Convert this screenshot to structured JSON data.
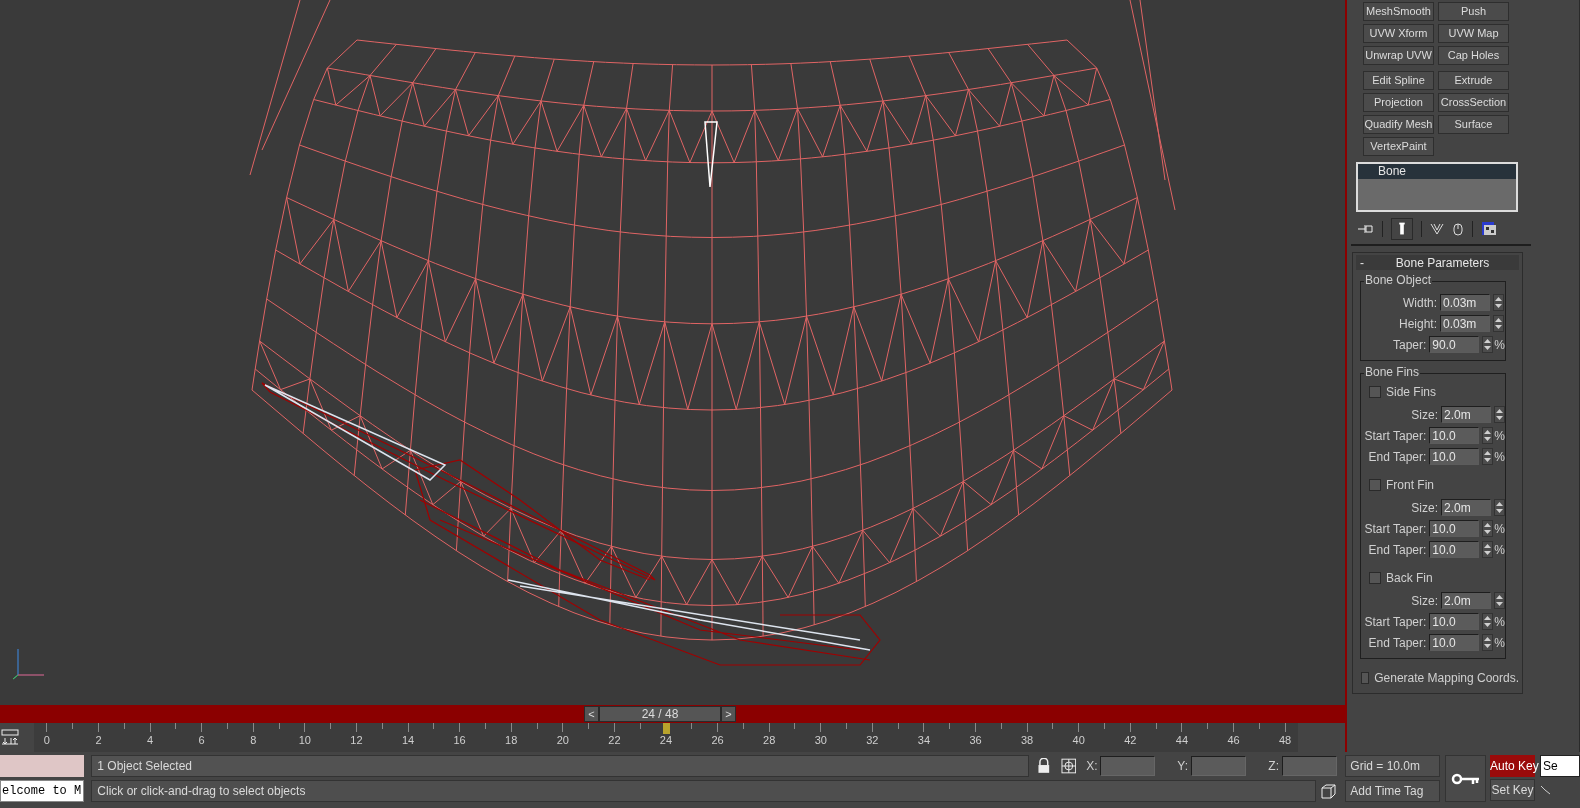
{
  "viewport": {
    "time_slider": {
      "prev": "<",
      "label": "24 / 48",
      "next": ">"
    }
  },
  "timeline": {
    "ticks": [
      "0",
      "2",
      "4",
      "6",
      "8",
      "10",
      "12",
      "14",
      "16",
      "18",
      "20",
      "22",
      "24",
      "26",
      "28",
      "30",
      "32",
      "34",
      "36",
      "38",
      "40",
      "42",
      "44",
      "46",
      "48"
    ],
    "level": 0.5
  },
  "command_panel": {
    "modifier_groups": [
      [
        "MeshSmooth",
        "Push",
        "UVW Xform",
        "UVW Map",
        "Unwrap UVW",
        "Cap Holes"
      ],
      [
        "Edit Spline",
        "Extrude",
        "Projection",
        "CrossSection",
        "Quadify Mesh",
        "Surface",
        "VertexPaint"
      ]
    ],
    "modifier_stack": [
      {
        "label": "Bone",
        "selected": true
      }
    ],
    "rollout": {
      "toggle": "-",
      "title": "Bone Parameters",
      "bone_object": {
        "title": "Bone Object",
        "rows": [
          {
            "label": "Width:",
            "value": "0.03m"
          },
          {
            "label": "Height:",
            "value": "0.03m"
          },
          {
            "label": "Taper:",
            "value": "90.0",
            "unit": "%"
          }
        ]
      },
      "bone_fins": {
        "title": "Bone Fins",
        "sections": [
          {
            "label": "Side Fins",
            "checked": false,
            "rows": [
              {
                "label": "Size:",
                "value": "2.0m"
              },
              {
                "label": "Start Taper:",
                "value": "10.0",
                "unit": "%"
              },
              {
                "label": "End Taper:",
                "value": "10.0",
                "unit": "%"
              }
            ]
          },
          {
            "label": "Front Fin",
            "checked": false,
            "rows": [
              {
                "label": "Size:",
                "value": "2.0m"
              },
              {
                "label": "Start Taper:",
                "value": "10.0",
                "unit": "%"
              },
              {
                "label": "End Taper:",
                "value": "10.0",
                "unit": "%"
              }
            ]
          },
          {
            "label": "Back Fin",
            "checked": false,
            "rows": [
              {
                "label": "Size:",
                "value": "2.0m"
              },
              {
                "label": "Start Taper:",
                "value": "10.0",
                "unit": "%"
              },
              {
                "label": "End Taper:",
                "value": "10.0",
                "unit": "%"
              }
            ]
          }
        ]
      },
      "mapping": {
        "label": "Generate Mapping Coords.",
        "checked": false
      }
    }
  },
  "status_bar": {
    "listener": "elcome to M",
    "selection": "1 Object Selected",
    "prompt": "Click or click-and-drag to select objects",
    "coords": [
      {
        "label": "X:"
      },
      {
        "label": "Y:"
      },
      {
        "label": "Z:"
      }
    ],
    "grid": "Grid = 10.0m",
    "add_time_tag": "Add Time Tag",
    "auto_key": {
      "label": "Auto Key",
      "on": true
    },
    "set_key": "Set Key",
    "key_filter": "Se"
  }
}
